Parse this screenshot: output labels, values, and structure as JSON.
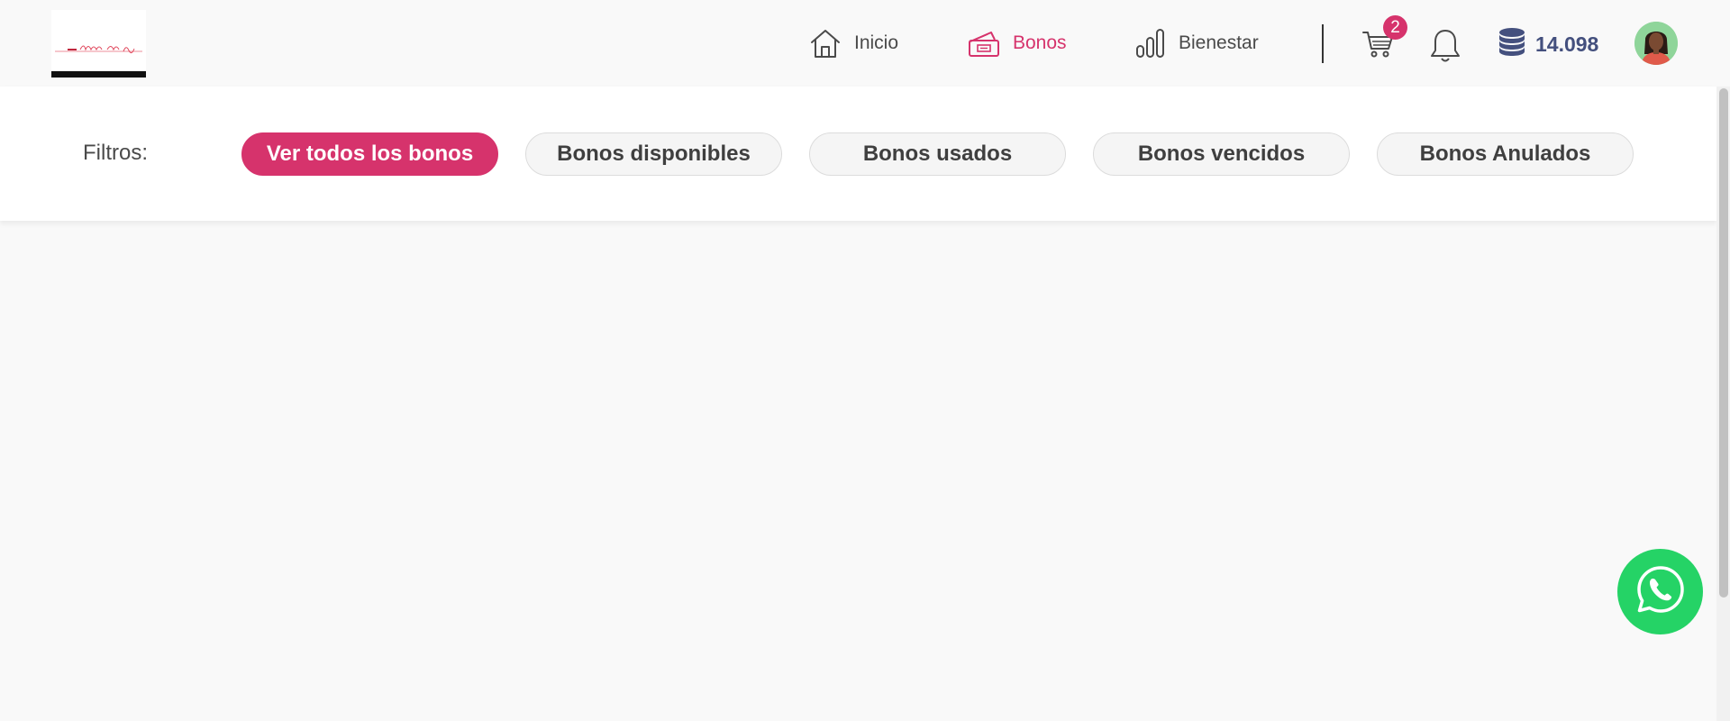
{
  "header": {
    "logo_alt": "Valentine's Day",
    "nav": [
      {
        "label": "Inicio",
        "icon": "home-icon",
        "active": false
      },
      {
        "label": "Bonos",
        "icon": "ticket-icon",
        "active": true
      },
      {
        "label": "Bienestar",
        "icon": "bar-chart-icon",
        "active": false
      }
    ],
    "cart_count": "2",
    "coins_balance": "14.098"
  },
  "filters": {
    "label": "Filtros:",
    "buttons": [
      {
        "label": "Ver todos los bonos",
        "active": true
      },
      {
        "label": "Bonos disponibles",
        "active": false
      },
      {
        "label": "Bonos usados",
        "active": false
      },
      {
        "label": "Bonos vencidos",
        "active": false
      },
      {
        "label": "Bonos Anulados",
        "active": false
      }
    ]
  },
  "colors": {
    "accent": "#d6336c",
    "coins": "#44507e",
    "whatsapp": "#25d366",
    "avatar_bg": "#8fd59a"
  }
}
